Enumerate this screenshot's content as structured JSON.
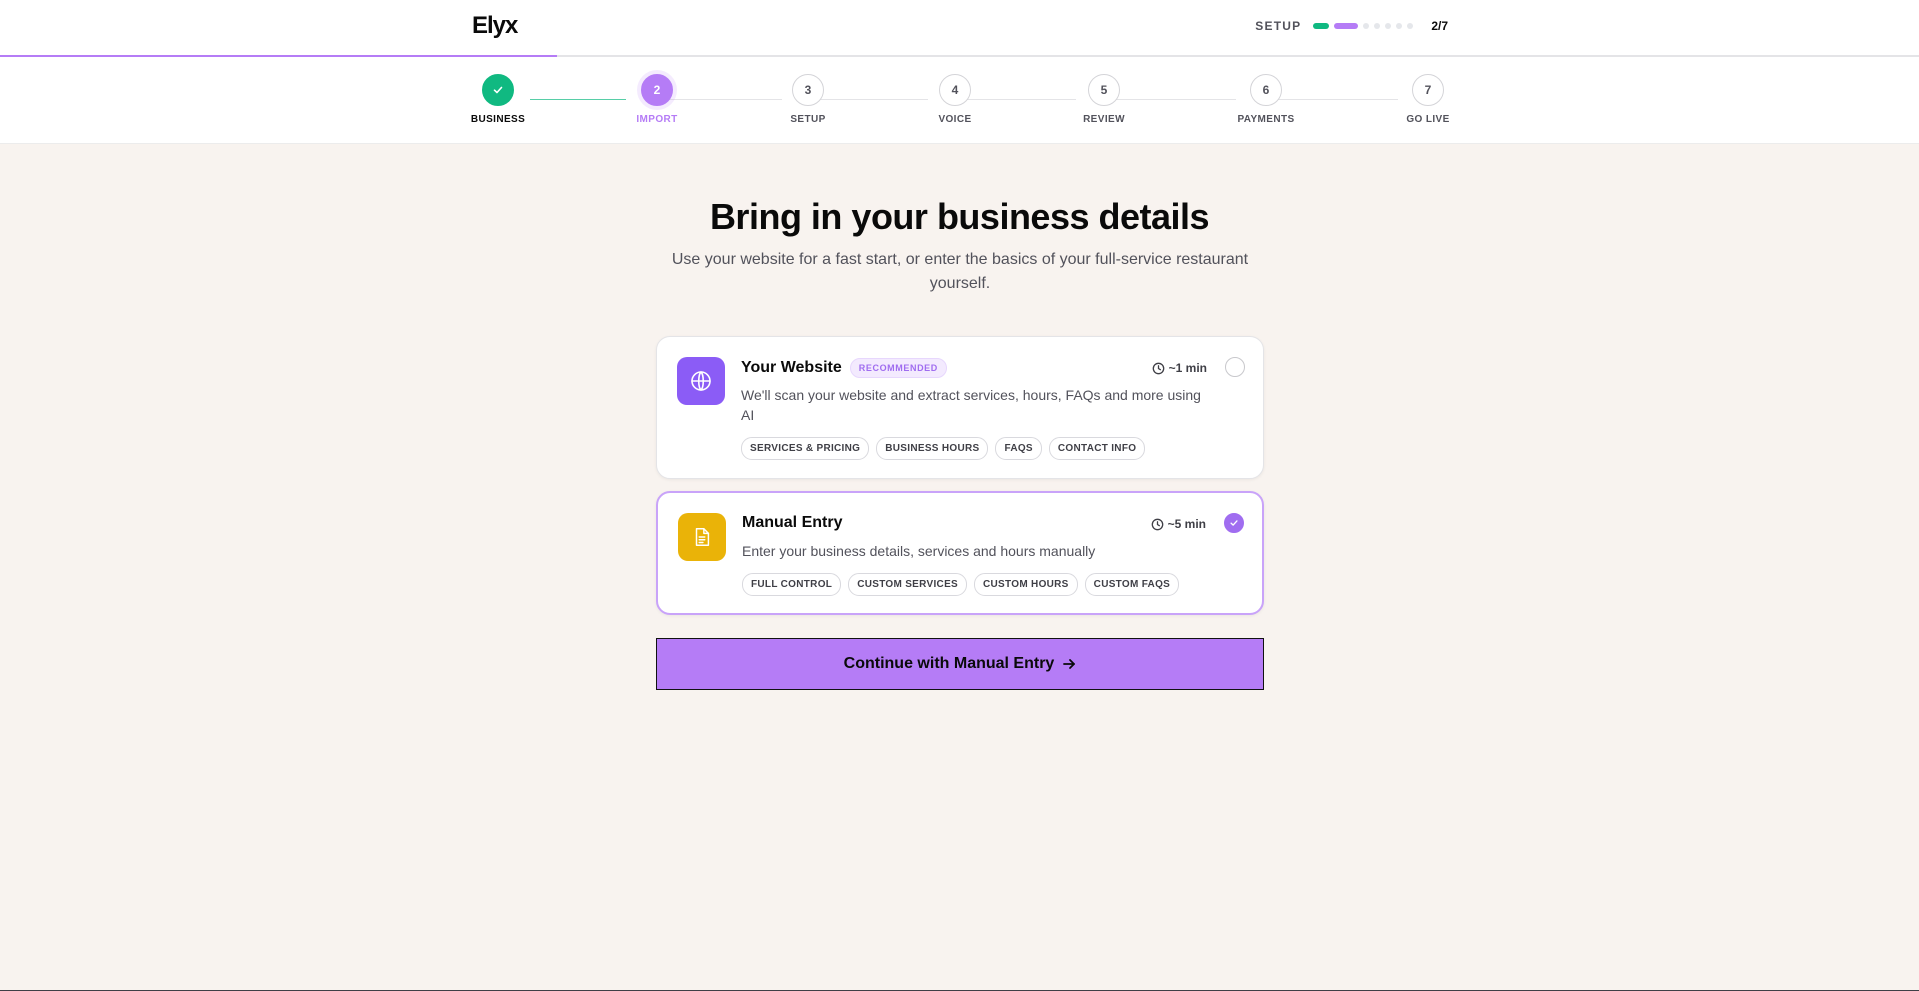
{
  "header": {
    "logo": "Elyx",
    "setup_label": "SETUP",
    "step_count": "2/7",
    "progress": {
      "current": 2,
      "total": 7
    }
  },
  "stepper": {
    "steps": [
      {
        "number": "1",
        "label": "BUSINESS",
        "state": "complete"
      },
      {
        "number": "2",
        "label": "IMPORT",
        "state": "active"
      },
      {
        "number": "3",
        "label": "SETUP",
        "state": "todo"
      },
      {
        "number": "4",
        "label": "VOICE",
        "state": "todo"
      },
      {
        "number": "5",
        "label": "REVIEW",
        "state": "todo"
      },
      {
        "number": "6",
        "label": "PAYMENTS",
        "state": "todo"
      },
      {
        "number": "7",
        "label": "GO LIVE",
        "state": "todo"
      }
    ]
  },
  "main": {
    "title": "Bring in your business details",
    "subtitle": "Use your website for a fast start, or enter the basics of your full-service restaurant yourself."
  },
  "options": [
    {
      "title": "Your Website",
      "badge": "RECOMMENDED",
      "time": "~1 min",
      "description": "We'll scan your website and extract services, hours, FAQs and more using AI",
      "chips": [
        "SERVICES & PRICING",
        "BUSINESS HOURS",
        "FAQS",
        "CONTACT INFO"
      ],
      "icon": "globe-icon",
      "selected": false
    },
    {
      "title": "Manual Entry",
      "time": "~5 min",
      "description": "Enter your business details, services and hours manually",
      "chips": [
        "FULL CONTROL",
        "CUSTOM SERVICES",
        "CUSTOM HOURS",
        "CUSTOM FAQS"
      ],
      "icon": "document-icon",
      "selected": true
    }
  ],
  "continue_label": "Continue with Manual Entry",
  "colors": {
    "accent": "#b57cf6",
    "success": "#10b981",
    "website_icon_bg": "#8b5cf6",
    "manual_icon_bg": "#eab308",
    "page_bg": "#f8f3ef"
  }
}
